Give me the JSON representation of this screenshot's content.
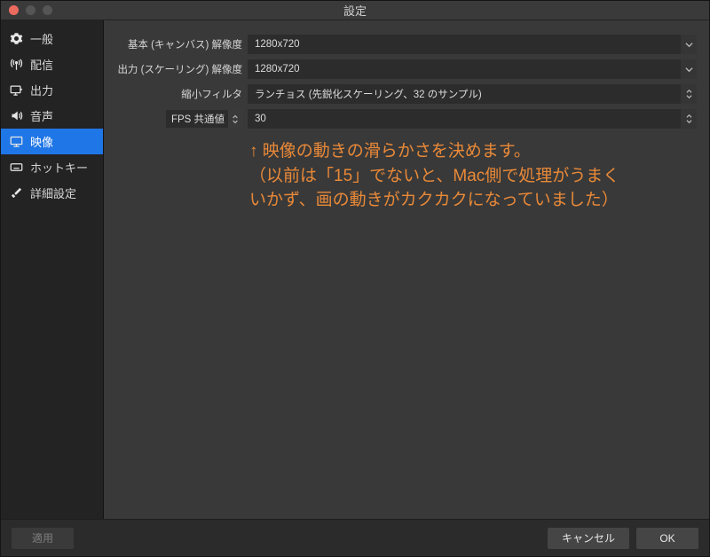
{
  "window": {
    "title": "設定"
  },
  "sidebar": {
    "items": [
      {
        "label": "一般"
      },
      {
        "label": "配信"
      },
      {
        "label": "出力"
      },
      {
        "label": "音声"
      },
      {
        "label": "映像"
      },
      {
        "label": "ホットキー"
      },
      {
        "label": "詳細設定"
      }
    ],
    "active_index": 4
  },
  "rows": {
    "base_res": {
      "label": "基本 (キャンバス) 解像度",
      "value": "1280x720"
    },
    "output_res": {
      "label": "出力 (スケーリング) 解像度",
      "value": "1280x720"
    },
    "filter": {
      "label": "縮小フィルタ",
      "value": "ランチョス (先鋭化スケーリング、32 のサンプル)"
    },
    "fps": {
      "label": "FPS 共通値",
      "value": "30"
    }
  },
  "annotation": "↑ 映像の動きの滑らかさを決めます。\n（以前は「15」でないと、Mac側で処理がうまくいかず、画の動きがカクカクになっていました）",
  "footer": {
    "apply": "適用",
    "cancel": "キャンセル",
    "ok": "OK"
  },
  "colors": {
    "accent": "#1f76e6",
    "annotation": "#e98938"
  }
}
